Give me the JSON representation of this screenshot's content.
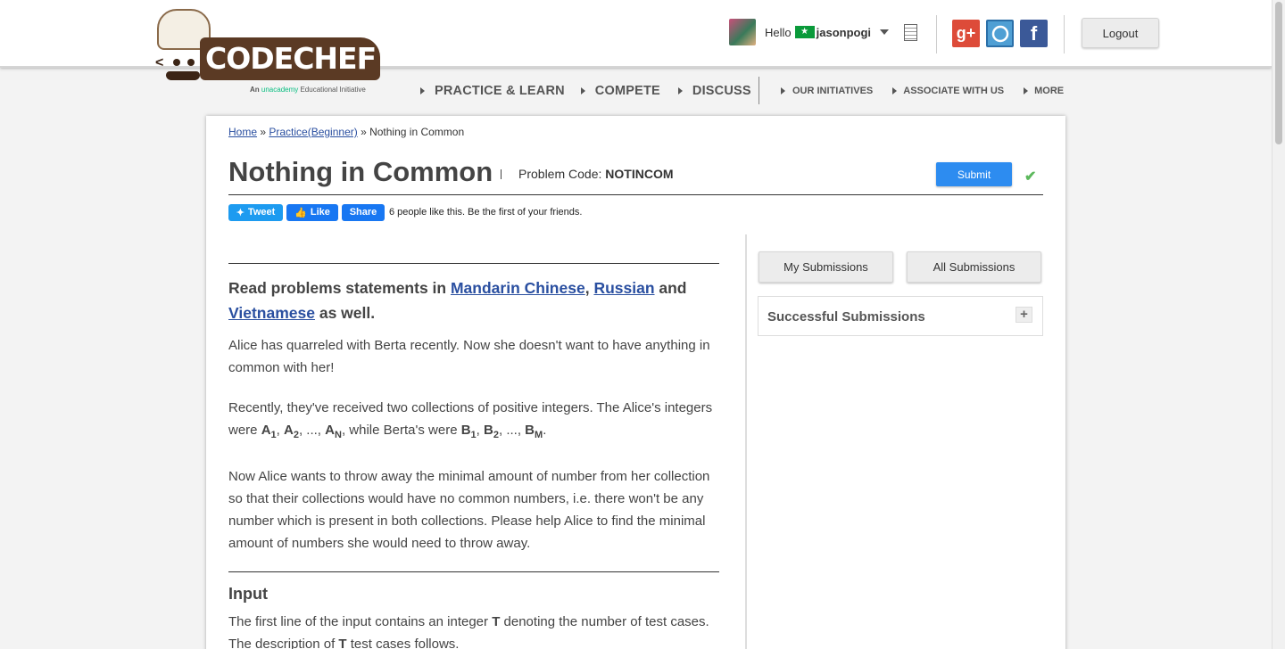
{
  "header": {
    "logo_text": "CODECHEF",
    "logo_tagline_prefix": "An ",
    "logo_tagline_brand": "unacademy",
    "logo_tagline_suffix": " Educational Initiative",
    "greeting": "Hello",
    "username": "jasonpogi",
    "logout_label": "Logout",
    "social": {
      "gplus": "g+",
      "github": "gh",
      "facebook": "f"
    }
  },
  "nav": {
    "main": [
      "PRACTICE & LEARN",
      "COMPETE",
      "DISCUSS"
    ],
    "secondary": [
      "OUR INITIATIVES",
      "ASSOCIATE WITH US",
      "MORE"
    ]
  },
  "breadcrumb": {
    "home": "Home",
    "sep1": " » ",
    "practice": "Practice(Beginner)",
    "sep2": " » ",
    "current": "Nothing in Common"
  },
  "problem": {
    "title": "Nothing in Common",
    "code_label": "Problem Code: ",
    "code": "NOTINCOM",
    "submit_label": "Submit"
  },
  "social_row": {
    "tweet": "Tweet",
    "like": "Like",
    "share": "Share",
    "likes_text": "6 people like this. Be the first of your friends."
  },
  "statement": {
    "read_prefix": "Read problems statements in ",
    "lang1": "Mandarin Chinese",
    "comma": ", ",
    "lang2": "Russian",
    "and": " and ",
    "lang3": "Vietnamese",
    "read_suffix": " as well.",
    "para1": "Alice has quarreled with Berta recently. Now she doesn't want to have anything in common with her!",
    "para3": "Now Alice wants to throw away the minimal amount of number from her collection so that their collections would have no common numbers, i.e. there won't be any number which is present in both collections. Please help Alice to find the minimal amount of numbers she would need to throw away.",
    "input_heading": "Input",
    "input_p1": "The first line of the input contains an integer ",
    "input_p2": " denoting the number of test cases.",
    "input_p3": "The description of ",
    "input_p4": " test cases follows."
  },
  "sidebar": {
    "my_submissions": "My Submissions",
    "all_submissions": "All Submissions",
    "successful_submissions": "Successful Submissions",
    "expand": "+"
  },
  "colors": {
    "brand": "#5b3a24",
    "link": "#2a4fa0",
    "submit": "#2d8cf0",
    "check": "#5cb85c"
  }
}
